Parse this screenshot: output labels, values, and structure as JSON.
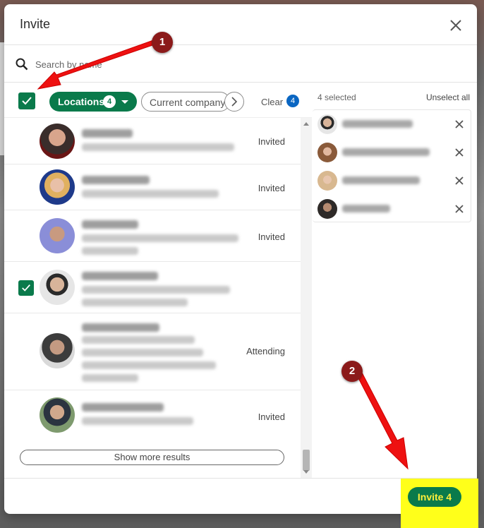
{
  "modal": {
    "title": "Invite",
    "search_placeholder": "Search by name"
  },
  "filters": {
    "locations_label": "Locations",
    "locations_count": "4",
    "company_label": "Current company",
    "clear_label": "Clear",
    "clear_count": "4"
  },
  "results": [
    {
      "status": "Invited",
      "checked": false
    },
    {
      "status": "Invited",
      "checked": false
    },
    {
      "status": "Invited",
      "checked": false
    },
    {
      "status": "",
      "checked": true
    },
    {
      "status": "Attending",
      "checked": false
    },
    {
      "status": "Invited",
      "checked": false
    }
  ],
  "show_more_label": "Show more results",
  "selected": {
    "count_label": "4 selected",
    "unselect_all_label": "Unselect all"
  },
  "footer": {
    "invite_label": "Invite 4"
  },
  "annotations": {
    "badge_1": "1",
    "badge_2": "2"
  },
  "colors": {
    "accent_green": "#0a7a4b",
    "badge_blue": "#0a66c2",
    "arrow_red": "#ee1111",
    "highlight_yellow": "#ffff1a",
    "badge_maroon": "#8b1a1a"
  }
}
